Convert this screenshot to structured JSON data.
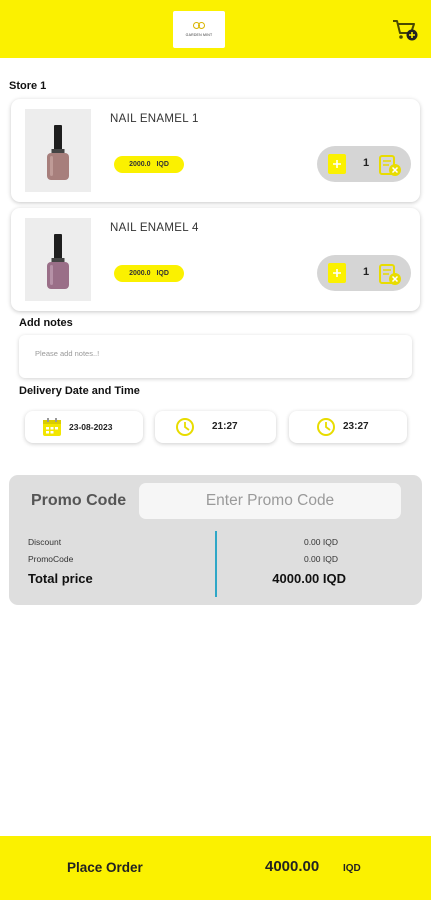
{
  "header": {
    "logo_text": "GARDEN MINT",
    "cart_icon": "cart-add-icon",
    "brand_color": "#fbf100"
  },
  "store": {
    "title": "Store 1",
    "items": [
      {
        "name": "NAIL ENAMEL 1",
        "price": "2000.0",
        "currency": "IQD",
        "quantity": "1",
        "polish_color": "#a77f7c"
      },
      {
        "name": "NAIL ENAMEL 4",
        "price": "2000.0",
        "currency": "IQD",
        "quantity": "1",
        "polish_color": "#9a6f88"
      }
    ]
  },
  "notes": {
    "label": "Add notes",
    "placeholder": "Please add notes..!"
  },
  "delivery": {
    "label": "Delivery Date and Time",
    "date": "23-08-2023",
    "time_from": "21:27",
    "time_to": "23:27"
  },
  "promo": {
    "label": "Promo Code",
    "placeholder": "Enter Promo Code",
    "discount_label": "Discount",
    "discount_value": "0.00 IQD",
    "promocode_label": "PromoCode",
    "promocode_value": "0.00 IQD",
    "total_label": "Total price",
    "total_value": "4000.00 IQD",
    "divider_color": "#2ea7c7"
  },
  "footer": {
    "place_order_label": "Place Order",
    "total": "4000.00",
    "currency": "IQD"
  }
}
